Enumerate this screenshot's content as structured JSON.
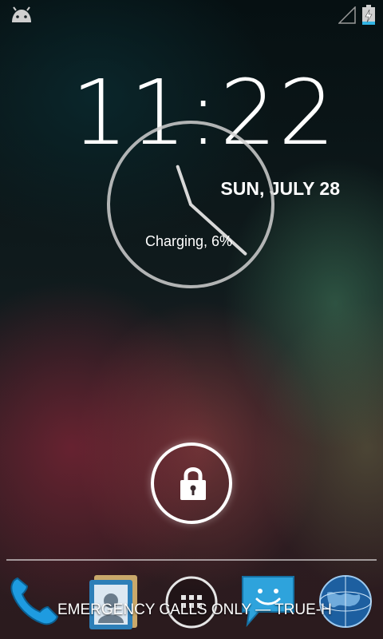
{
  "status_bar": {
    "left_icon": "android-debug-icon",
    "signal_icon": "signal-empty-icon",
    "battery_icon": "battery-charging-icon"
  },
  "lockscreen": {
    "time": "11:22",
    "date": "SUN, JULY 28",
    "charging_status": "Charging, 6%",
    "analog_clock": {
      "hour": 11,
      "minute": 22
    },
    "carrier_text": "EMERGENCY CALLS ONLY — TRUE-H",
    "unlock_icon": "lock-icon"
  },
  "dock": {
    "items": [
      "phone-icon",
      "contacts-icon",
      "all-apps-icon",
      "messaging-icon",
      "browser-icon"
    ]
  },
  "colors": {
    "text": "#ffffff",
    "phone_blue": "#1e9be0",
    "messaging_blue": "#2ea3dc"
  }
}
